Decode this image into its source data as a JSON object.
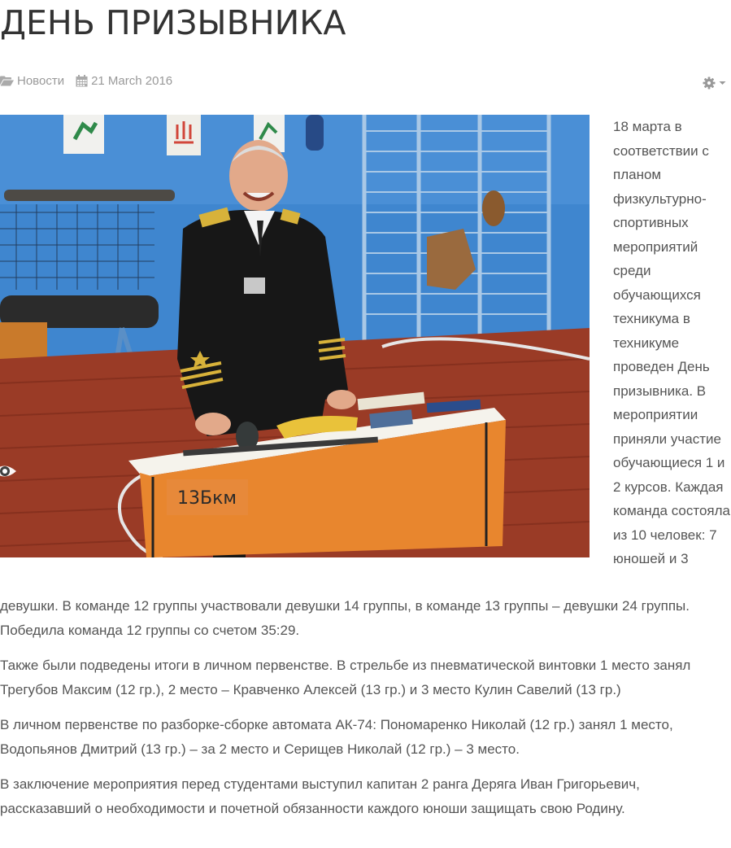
{
  "article": {
    "title": "ДЕНЬ ПРИЗЫВНИКА",
    "category": "Новости",
    "date": "21 March 2016",
    "intro_wrap": "18 марта в соответствии с планом физкультурно-спортивных мероприятий среди обучающихся техникума в техникуме проведен День призывника. В мероприятии приняли участие обучающиеся 1 и 2 курсов. Каждая команда состояла из 10 человек: 7 юношей и 3",
    "intro_cont": "девушки. В команде 12 группы участвовали девушки 14 группы, в команде 13 группы – девушки 24 группы. Победила команда 12 группы со счетом 35:29.",
    "paragraphs": [
      "Также были подведены итоги в личном первенстве. В стрельбе из пневматической винтовки 1 место занял Трегубов Максим (12 гр.), 2 место – Кравченко Алексей (13 гр.) и 3 место Кулин Савелий (13 гр.)",
      "В личном первенстве по разборке-сборке автомата АК-74: Пономаренко Николай (12 гр.) занял 1 место, Водопьянов Дмитрий (13 гр.) – за 2 место и Серищев Николай (12 гр.) – 3 место.",
      "В заключение мероприятия перед студентами выступил капитан 2 ранга Деряга Иван Григорьевич, рассказавший о необходимости и почетной обязанности каждого юноши защищать свою Родину."
    ],
    "photo_desk_sign": "13Бкм"
  },
  "icons": {
    "category": "folder-open-icon",
    "date": "calendar-icon",
    "tools": "gear-icon",
    "tools_caret": "caret-down-icon",
    "photo_overlay": "eye-icon"
  },
  "colors": {
    "text": "#555555",
    "title": "#333333",
    "meta": "#999999"
  }
}
